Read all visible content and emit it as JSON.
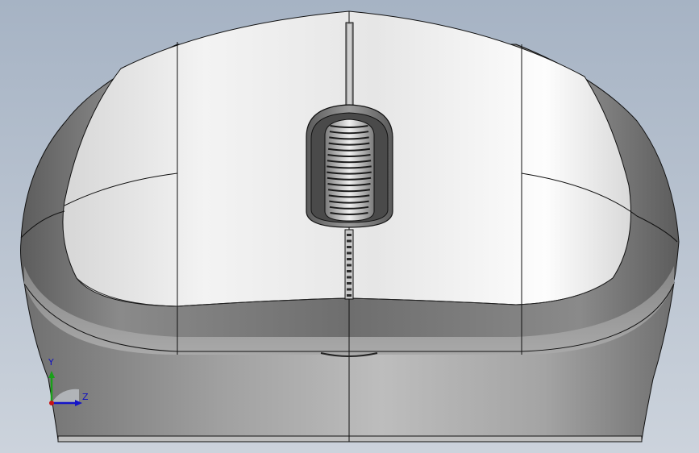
{
  "viewport": {
    "background_top": "#a7b4c5",
    "background_bottom": "#c9d0da"
  },
  "model": {
    "shell_color": "#ededed",
    "grip_color": "#7d7d7d",
    "edge_color": "#111111",
    "wheel_rib_color": "#1a1a1a"
  },
  "triad": {
    "y_label": "Y",
    "z_label": "Z",
    "y_color": "#19a019",
    "z_color": "#1414c8",
    "x_color": "#c81414"
  }
}
